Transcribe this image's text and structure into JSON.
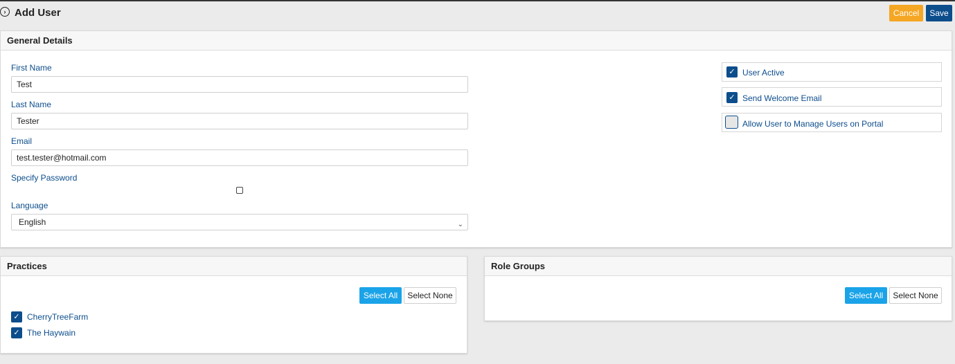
{
  "header": {
    "title": "Add User",
    "cancel_label": "Cancel",
    "save_label": "Save"
  },
  "general": {
    "heading": "General Details",
    "first_name": {
      "label": "First Name",
      "value": "Test"
    },
    "last_name": {
      "label": "Last Name",
      "value": "Tester"
    },
    "email": {
      "label": "Email",
      "value": "test.tester@hotmail.com"
    },
    "specify_password": {
      "label": "Specify Password",
      "checked": false
    },
    "language": {
      "label": "Language",
      "value": "English"
    },
    "options": [
      {
        "label": "User Active",
        "checked": true
      },
      {
        "label": "Send Welcome Email",
        "checked": true
      },
      {
        "label": "Allow User to Manage Users on Portal",
        "checked": false
      }
    ]
  },
  "practices": {
    "heading": "Practices",
    "select_all_label": "Select All",
    "select_none_label": "Select None",
    "items": [
      {
        "label": "CherryTreeFarm",
        "checked": true
      },
      {
        "label": "The Haywain",
        "checked": true
      }
    ]
  },
  "roles": {
    "heading": "Role Groups",
    "select_all_label": "Select All",
    "select_none_label": "Select None"
  },
  "icons": {
    "back": "circle-chevron-right-icon",
    "check": "check-icon",
    "dropdown": "chevron-down-icon"
  },
  "colors": {
    "primary": "#0c4d8c",
    "cancel": "#f5a623",
    "select_all": "#1aa3e8"
  }
}
